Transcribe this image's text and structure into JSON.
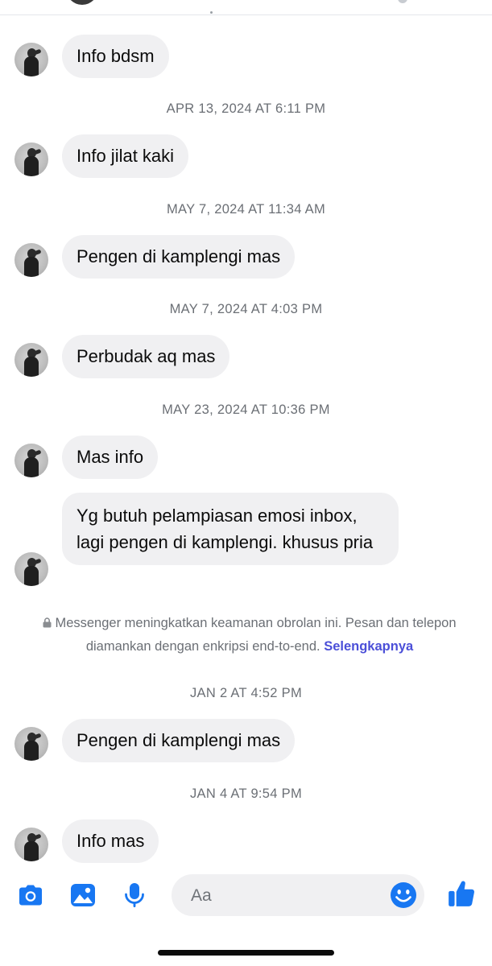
{
  "colors": {
    "accent": "#1877f2",
    "bubble_bg": "#f0f0f2",
    "timestamp_text": "#6b6f75",
    "link": "#4b4fd8"
  },
  "messages": [
    {
      "text": "Info bdsm"
    },
    {
      "timestamp": "APR 13, 2024 AT 6:11 PM",
      "text": "Info jilat kaki"
    },
    {
      "timestamp": "MAY 7, 2024 AT 11:34 AM",
      "text": "Pengen di kamplengi mas"
    },
    {
      "timestamp": "MAY 7, 2024 AT 4:03 PM",
      "text": "Perbudak aq mas"
    },
    {
      "timestamp": "MAY 23, 2024 AT 10:36 PM",
      "text": "Mas info"
    },
    {
      "text": "Yg butuh pelampiasan emosi inbox, lagi pengen di kamplengi. khusus pria"
    }
  ],
  "encryption_notice": {
    "icon": "lock-icon",
    "text": "Messenger meningkatkan keamanan obrolan ini. Pesan dan telepon diamankan dengan enkripsi end-to-end.",
    "link": "Selengkapnya"
  },
  "later_messages": [
    {
      "timestamp": "JAN 2 AT 4:52 PM",
      "text": "Pengen di kamplengi mas"
    },
    {
      "timestamp": "JAN 4 AT 9:54 PM",
      "text": "Info mas"
    }
  ],
  "composer": {
    "placeholder": "Aa",
    "icons": [
      "camera-icon",
      "gallery-icon",
      "microphone-icon",
      "emoji-icon",
      "thumbs-up-icon"
    ]
  }
}
